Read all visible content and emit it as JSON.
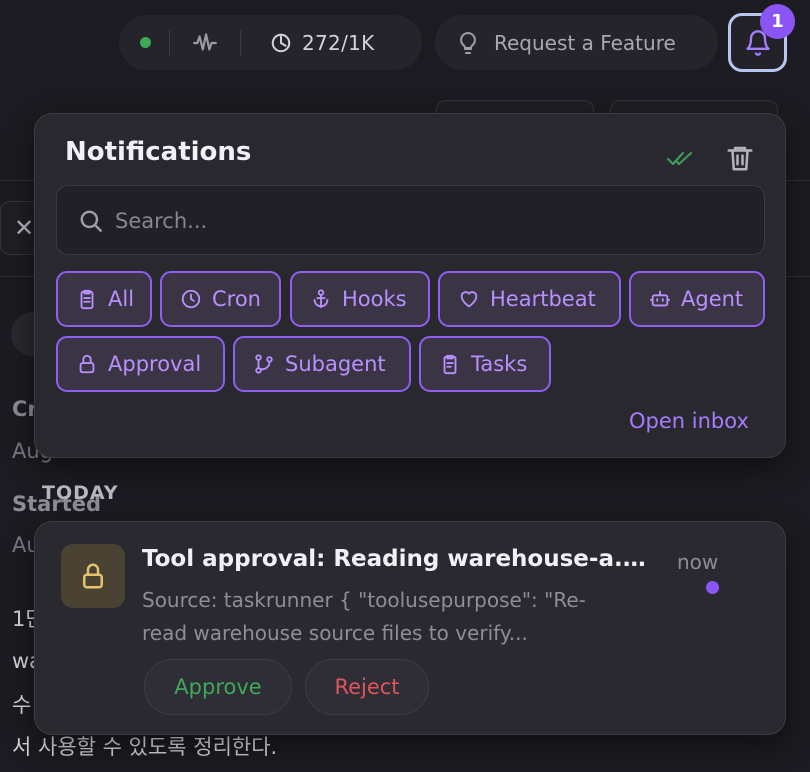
{
  "topbar": {
    "token_count": "272/1K",
    "request_feature_label": "Request a Feature",
    "notification_count": "1"
  },
  "notifications": {
    "title": "Notifications",
    "search_placeholder": "Search...",
    "filters": [
      {
        "label": "All",
        "icon": "clipboard-icon"
      },
      {
        "label": "Cron",
        "icon": "clock-icon"
      },
      {
        "label": "Hooks",
        "icon": "anchor-icon"
      },
      {
        "label": "Heartbeat",
        "icon": "heart-icon"
      },
      {
        "label": "Agent",
        "icon": "bot-icon"
      },
      {
        "label": "Approval",
        "icon": "lock-icon"
      },
      {
        "label": "Subagent",
        "icon": "git-branch-icon"
      },
      {
        "label": "Tasks",
        "icon": "clipboard-list-icon"
      }
    ],
    "open_inbox_label": "Open inbox",
    "group_label": "TODAY",
    "items": [
      {
        "title": "Tool approval: Reading warehouse-a.m...",
        "time": "now",
        "body_line1": "Source: taskrunner { \"toolusepurpose\": \"Re-",
        "body_line2": "read warehouse source files to verify...",
        "approve_label": "Approve",
        "reject_label": "Reject"
      }
    ]
  },
  "background": {
    "label_created": "Cr",
    "date_created": "Aug",
    "label_started": "Started",
    "date_started": "Au",
    "korean_line1": "1단",
    "korean_line2": "wa",
    "korean_line3": "수",
    "korean_line4": "서 사용할 수 있도록 정리한다."
  },
  "colors": {
    "accent": "#8b55f5",
    "approve": "#3fa85a",
    "reject": "#e0545c",
    "status_online": "#3fa85a"
  }
}
